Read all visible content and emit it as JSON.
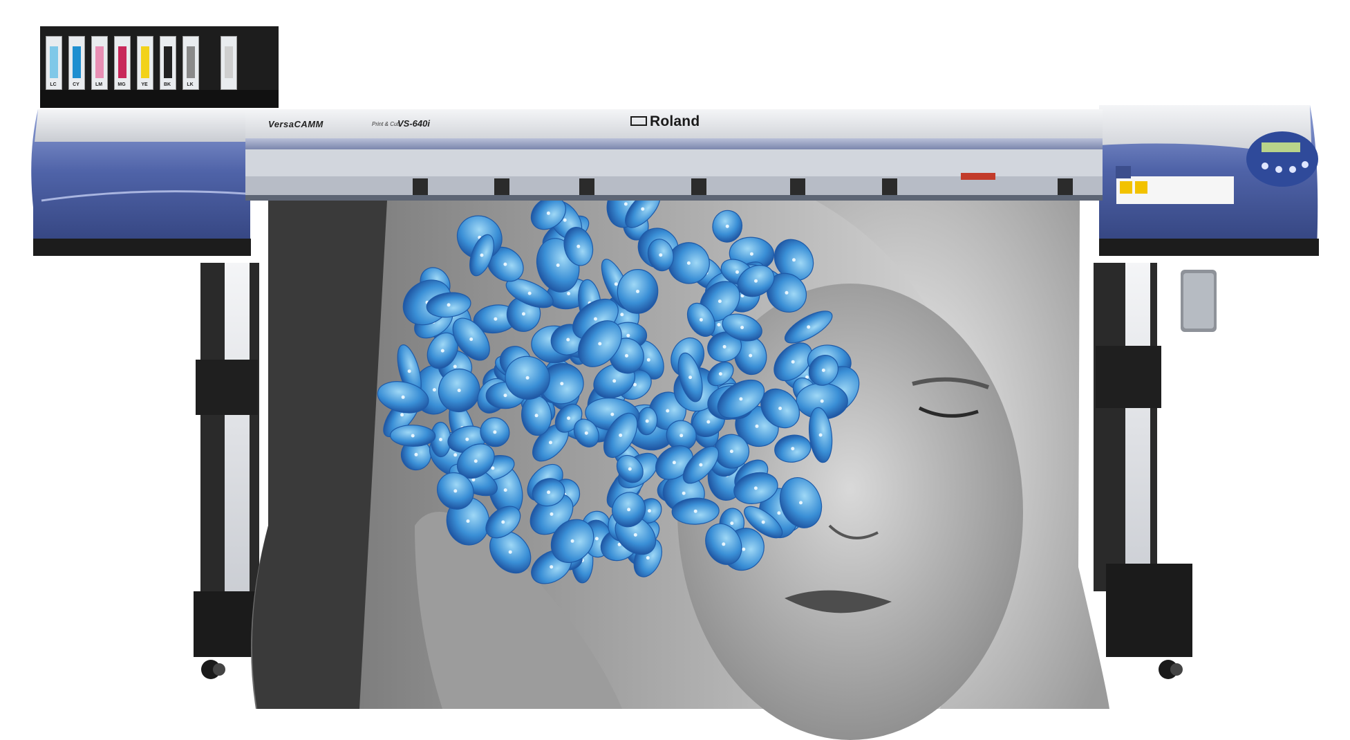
{
  "printer": {
    "series_name": "VersaCAMM",
    "series_sub": "Print & Cut",
    "model": "VS-640i",
    "brand": "Roland"
  },
  "cartridges": [
    {
      "label": "LC",
      "color": "#7fc8e8"
    },
    {
      "label": "CY",
      "color": "#1f8fd0"
    },
    {
      "label": "LM",
      "color": "#e88fb4"
    },
    {
      "label": "MG",
      "color": "#c8285a"
    },
    {
      "label": "YE",
      "color": "#f2d21a"
    },
    {
      "label": "BK",
      "color": "#222222"
    },
    {
      "label": "LK",
      "color": "#8a8a8a"
    },
    {
      "label": "",
      "color": "#cfcfcf"
    }
  ],
  "colors": {
    "body_blue": "#4f63a8",
    "body_blue_light": "#8b9ad0",
    "frame_silver": "#dfe2e6",
    "hydrangea": "#3a8fd6"
  }
}
